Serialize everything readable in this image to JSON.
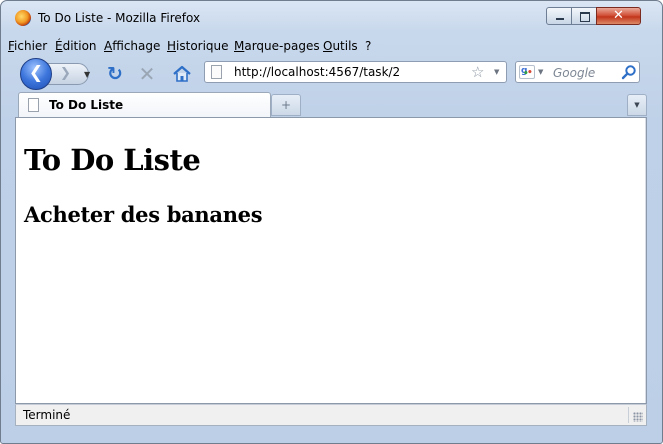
{
  "window": {
    "title": "To Do Liste - Mozilla Firefox",
    "close_glyph": "✕"
  },
  "menu": {
    "items": [
      {
        "label": "Fichier"
      },
      {
        "label": "Édition"
      },
      {
        "label": "Affichage"
      },
      {
        "label": "Historique"
      },
      {
        "label": "Marque-pages"
      },
      {
        "label": "Outils"
      },
      {
        "label": "?"
      }
    ]
  },
  "nav": {
    "back_glyph": "❮",
    "forward_glyph": "❯",
    "history_glyph": "▼",
    "reload_glyph": "↻",
    "stop_glyph": "✕",
    "url": "http://localhost:4567/task/2",
    "star_glyph": "☆",
    "url_dropdown_glyph": "▼"
  },
  "search": {
    "placeholder": "Google",
    "engine_dropdown_glyph": "▼"
  },
  "tabs": {
    "items": [
      {
        "label": "To Do Liste"
      }
    ],
    "new_tab_glyph": "+",
    "list_glyph": "▼"
  },
  "page": {
    "heading": "To Do Liste",
    "task": "Acheter des bananes"
  },
  "status": {
    "text": "Terminé"
  },
  "colors": {
    "chrome": "#c8d8ec",
    "accent": "#2e6fc7",
    "close": "#c1351c"
  },
  "icons": [
    "firefox-icon",
    "back-icon",
    "forward-icon",
    "reload-icon",
    "stop-icon",
    "home-icon",
    "page-icon",
    "bookmark-star-icon",
    "google-icon",
    "magnifier-icon",
    "new-tab-icon",
    "tab-list-icon",
    "resize-grip-icon"
  ]
}
